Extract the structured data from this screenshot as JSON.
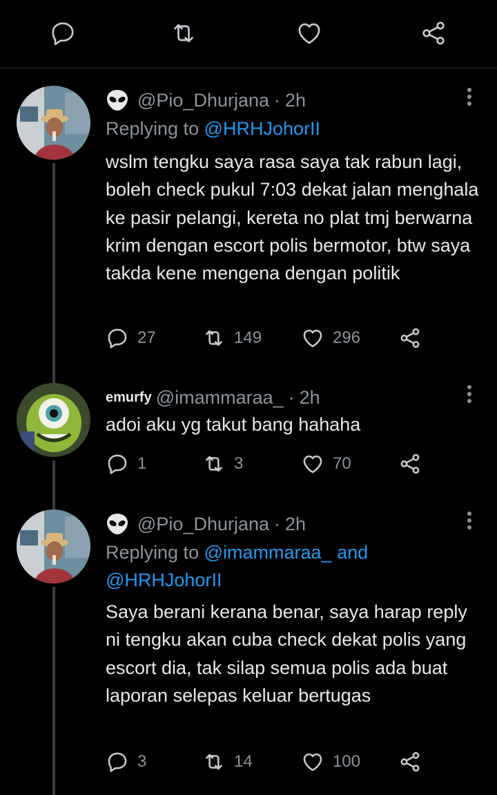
{
  "colors": {
    "background": "#000000",
    "text": "#e7e9ea",
    "muted": "#8b949b",
    "link": "#1d9bf0",
    "divider": "#2f3336"
  },
  "topbar": {
    "icons": [
      "reply-icon",
      "retweet-icon",
      "like-icon",
      "share-icon"
    ]
  },
  "tweets": [
    {
      "handle": "@Pio_Dhurjana",
      "time": "2h",
      "replying_prefix": "Replying to",
      "replying_to": [
        "@HRHJohorII"
      ],
      "body": "wslm tengku saya rasa saya tak rabun lagi, boleh check pukul 7:03 dekat jalan menghala ke pasir pelangi, kereta no plat tmj berwarna krim dengan escort polis bermotor, btw saya takda kene mengena dengan politik",
      "counts": {
        "replies": "27",
        "retweets": "149",
        "likes": "296"
      }
    },
    {
      "display_name": "emurfy",
      "handle": "@imammaraa_",
      "time": "2h",
      "body": "adoi aku yg takut bang hahaha",
      "counts": {
        "replies": "1",
        "retweets": "3",
        "likes": "70"
      }
    },
    {
      "handle": "@Pio_Dhurjana",
      "time": "2h",
      "replying_prefix": "Replying to",
      "replying_to": [
        "@imammaraa_",
        "@HRHJohorII"
      ],
      "replying_joiner": "and",
      "body": "Saya berani kerana benar, saya harap reply ni tengku akan cuba check dekat polis yang escort dia, tak silap semua polis ada buat laporan selepas keluar bertugas",
      "counts": {
        "replies": "3",
        "retweets": "14",
        "likes": "100"
      }
    }
  ]
}
